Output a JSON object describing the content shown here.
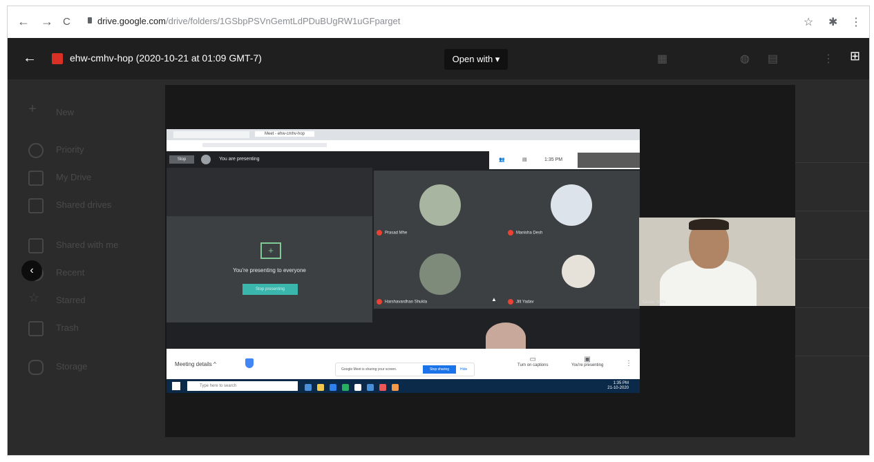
{
  "browser": {
    "nav": {
      "back": "←",
      "forward": "→",
      "reload": "C"
    },
    "lock_icon": "lock-icon",
    "url_host": "drive.google.com",
    "url_path": "/drive/folders/1GSbpPSVnGemtLdPDuBUgRW1uGFparget",
    "right_icons": [
      "star-icon",
      "extension-icon",
      "menu-icon"
    ]
  },
  "viewer": {
    "file_name": "ehw-cmhv-hop (2020-10-21 at 01:09 GMT-7)",
    "open_with": "Open with ▾",
    "sidebar": [
      "New",
      "Priority",
      "My Drive",
      "Shared drives",
      "Shared with me",
      "Recent",
      "Starred",
      "Trash",
      "Storage"
    ]
  },
  "meeting": {
    "browser_tabs": [
      "Meet - ehw-cmhv-hop"
    ],
    "stop_label": "Stop",
    "presenting_banner": "You are presenting",
    "right_time": "1:35 PM",
    "present_title": "You're presenting to everyone",
    "stop_presenting": "Stop presenting",
    "participants": [
      {
        "name": "Prasad Mhe"
      },
      {
        "name": "Manisha Desh"
      },
      {
        "name": "Harshavardhan Shukla"
      },
      {
        "name": "Jilt Yadav"
      }
    ],
    "meeting_details": "Meeting details ^",
    "notify_msg": "Google Meet is sharing your screen.",
    "notify_btn": "Stop sharing",
    "notify_hide": "Hide",
    "bottom_right": [
      {
        "icon": "▭",
        "label": "Turn on captions"
      },
      {
        "icon": "▣",
        "label": "You're presenting"
      }
    ],
    "taskbar_search": "Type here to search",
    "taskbar_time": "1:35 PM\n21-10-2020",
    "taskbar_icon_colors": [
      "#4a90d9",
      "#f2c94c",
      "#2f80ed",
      "#27ae60",
      "#ffffff",
      "#4a90d9",
      "#eb5757",
      "#f2994a"
    ],
    "self_name": "Saurav Sethi"
  }
}
